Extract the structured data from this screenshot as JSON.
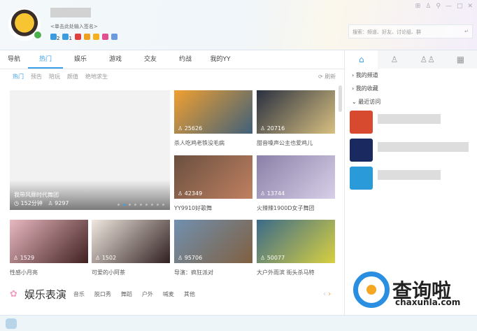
{
  "profile": {
    "signature": "<单击此处输入签名>",
    "badges": [
      {
        "label": "2",
        "color": "#3a9be0"
      },
      {
        "label": "1",
        "color": "#3a9be0"
      },
      {
        "label": "",
        "color": "#e04040"
      },
      {
        "label": "",
        "color": "#f0a020"
      },
      {
        "label": "",
        "color": "#f5b020"
      },
      {
        "label": "",
        "color": "#e05090"
      },
      {
        "label": "",
        "color": "#6a9ae0"
      }
    ]
  },
  "window_controls": [
    "⊞",
    "♙",
    "⚲",
    "—",
    "□",
    "✕"
  ],
  "search": {
    "placeholder": "搜索：频道、好友、讨论组、群",
    "enter": "↵"
  },
  "nav": {
    "tabs": [
      "导航",
      "热门",
      "娱乐",
      "游戏",
      "交友",
      "约战",
      "我的YY"
    ],
    "active": 1
  },
  "subnav": {
    "tabs": [
      "热门",
      "预告",
      "陪玩",
      "颜值",
      "绝地求生"
    ],
    "refresh": "刷新"
  },
  "featured": {
    "title": "我带风靡时代舞团",
    "duration": "◷ 152分钟",
    "viewers": "♙ 9297",
    "slides": 9,
    "active_slide": 1
  },
  "cards": [
    {
      "viewers": "♙ 25626",
      "caption": "杀人吃鸡老铁没毛病",
      "colors": [
        "#f0a030",
        "#40607a"
      ]
    },
    {
      "viewers": "♙ 20716",
      "caption": "甜音嗓声公主也爱鸡儿",
      "colors": [
        "#2a3040",
        "#d8c080"
      ]
    },
    {
      "viewers": "♙ 42349",
      "caption": "YY9910好歌舞",
      "colors": [
        "#6a5040",
        "#c08060"
      ]
    },
    {
      "viewers": "♙ 13744",
      "caption": "火辣辣1900D女子舞团",
      "colors": [
        "#8a80a8",
        "#d8d0e8"
      ]
    },
    {
      "viewers": "♙ 1529",
      "caption": "性感小月亮",
      "colors": [
        "#e8b8c0",
        "#402020"
      ]
    },
    {
      "viewers": "♙ 1502",
      "caption": "可爱的小阿茶",
      "colors": [
        "#f0e8e0",
        "#302020"
      ]
    },
    {
      "viewers": "♙ 95706",
      "caption": "导演：疯狂派对",
      "colors": [
        "#7090b0",
        "#806040"
      ]
    },
    {
      "viewers": "♙ 50077",
      "caption": "大户外雨滨 街头杀马特",
      "colors": [
        "#3a6a8a",
        "#d8d040"
      ]
    }
  ],
  "section": {
    "title": "娱乐表演",
    "tags": [
      "音乐",
      "脱口秀",
      "舞蹈",
      "户外",
      "喊麦",
      "其他"
    ],
    "prev": "‹",
    "next": "›"
  },
  "sidebar": {
    "tabs": [
      "⌂",
      "♙",
      "♙♙",
      "▦"
    ],
    "items": [
      "› 我的频道",
      "› 我的收藏",
      "⌄ 最近访问"
    ],
    "recent_colors": [
      "#d84a30",
      "#1a2a60",
      "#2a9ad8"
    ]
  },
  "watermark": {
    "text": "查询啦",
    "url": "chaxunla.com"
  }
}
